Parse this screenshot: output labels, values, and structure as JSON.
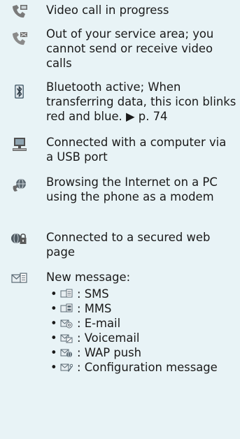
{
  "entries": [
    {
      "icon": "video-call-icon",
      "text": "Video call in progress"
    },
    {
      "icon": "video-call-out-of-service-icon",
      "text": "Out of your service area; you cannot send or receive video calls"
    },
    {
      "icon": "bluetooth-icon",
      "text": "Bluetooth active; When transferring data, this icon blinks red and blue. ▶ p. 74"
    },
    {
      "icon": "usb-computer-icon",
      "text": "Connected with a computer via a USB port"
    },
    {
      "icon": "modem-browsing-icon",
      "text": "Browsing the Internet on a PC using the phone as a modem"
    },
    {
      "icon": "secured-web-icon",
      "text": "Connected to a secured web page"
    },
    {
      "icon": "new-message-icon",
      "text": "New message:"
    }
  ],
  "message_types": [
    {
      "icon": "sms-icon",
      "text": ": SMS"
    },
    {
      "icon": "mms-icon",
      "text": ": MMS"
    },
    {
      "icon": "email-icon",
      "text": ": E-mail"
    },
    {
      "icon": "voicemail-icon",
      "text": ": Voicemail"
    },
    {
      "icon": "wap-push-icon",
      "text": ": WAP push"
    },
    {
      "icon": "configuration-message-icon",
      "text": ": Configuration message"
    }
  ],
  "bullet": "•"
}
